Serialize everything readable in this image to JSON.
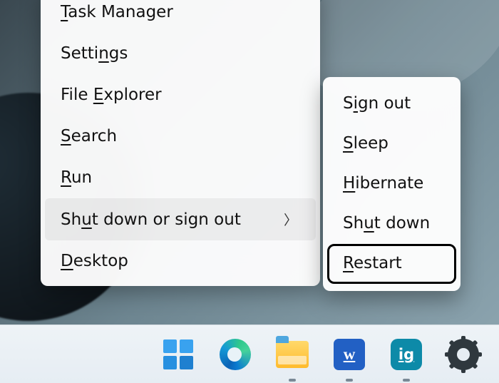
{
  "main_menu": {
    "items": [
      {
        "label": "Task Manager",
        "accelKey": "T",
        "hasSubmenu": false
      },
      {
        "label": "Settings",
        "accelKey": "n",
        "hasSubmenu": false
      },
      {
        "label": "File Explorer",
        "accelKey": "E",
        "hasSubmenu": false
      },
      {
        "label": "Search",
        "accelKey": "S",
        "hasSubmenu": false
      },
      {
        "label": "Run",
        "accelKey": "R",
        "hasSubmenu": false
      },
      {
        "label": "Shut down or sign out",
        "accelKey": "u",
        "hasSubmenu": true,
        "hovered": true
      },
      {
        "label": "Desktop",
        "accelKey": "D",
        "hasSubmenu": false
      }
    ]
  },
  "power_submenu": {
    "items": [
      {
        "label": "Sign out",
        "accelKey": "i"
      },
      {
        "label": "Sleep",
        "accelKey": "S"
      },
      {
        "label": "Hibernate",
        "accelKey": "H"
      },
      {
        "label": "Shut down",
        "accelKey": "u"
      },
      {
        "label": "Restart",
        "accelKey": "R",
        "highlighted": true
      }
    ]
  },
  "taskbar": {
    "items": [
      {
        "name": "start",
        "icon": "start-icon",
        "running": false
      },
      {
        "name": "microsoft-edge",
        "icon": "edge-icon",
        "running": false
      },
      {
        "name": "file-explorer",
        "icon": "file-explorer-icon",
        "running": true
      },
      {
        "name": "microsoft-word",
        "icon": "word-icon",
        "running": true
      },
      {
        "name": "ig-app",
        "icon": "ig-icon",
        "running": true
      },
      {
        "name": "settings",
        "icon": "gear-icon",
        "running": false
      }
    ]
  }
}
